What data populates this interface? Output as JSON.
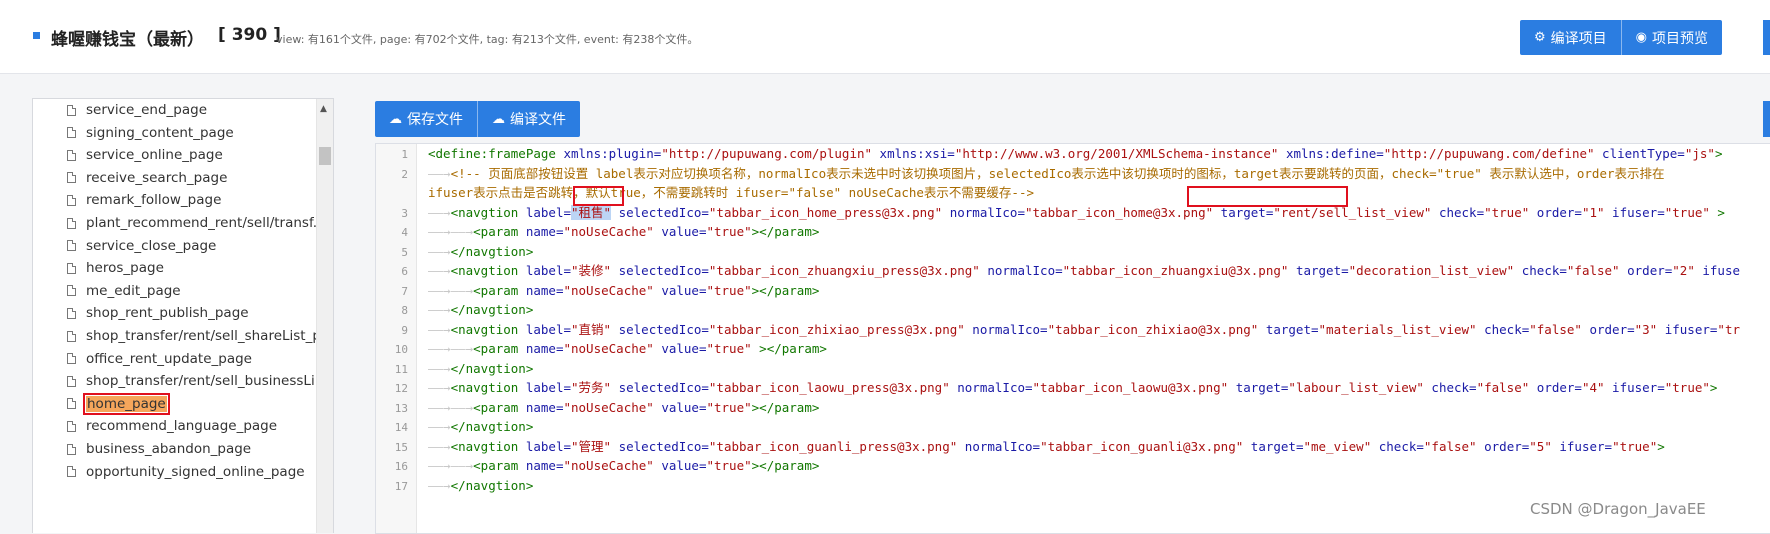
{
  "header": {
    "title": "蜂喔赚钱宝（最新）",
    "count": "[ 390 ]",
    "stats": "view: 有161个文件, page: 有702个文件, tag: 有213个文件, event: 有238个文件。",
    "compile_project_label": "编译项目",
    "preview_project_label": "项目预览"
  },
  "toolbar": {
    "save_file_label": "保存文件",
    "compile_file_label": "编译文件"
  },
  "sidebar": {
    "items": [
      {
        "label": "service_end_page"
      },
      {
        "label": "signing_content_page"
      },
      {
        "label": "service_online_page"
      },
      {
        "label": "receive_search_page"
      },
      {
        "label": "remark_follow_page"
      },
      {
        "label": "plant_recommend_rent/sell/transf..."
      },
      {
        "label": "service_close_page"
      },
      {
        "label": "heros_page"
      },
      {
        "label": "me_edit_page"
      },
      {
        "label": "shop_rent_publish_page"
      },
      {
        "label": "shop_transfer/rent/sell_shareList_p..."
      },
      {
        "label": "office_rent_update_page"
      },
      {
        "label": "shop_transfer/rent/sell_businessLi..."
      },
      {
        "label": "home_page",
        "selected": true
      },
      {
        "label": "recommend_language_page"
      },
      {
        "label": "business_abandon_page"
      },
      {
        "label": "opportunity_signed_online_page"
      }
    ]
  },
  "editor": {
    "line_numbers": [
      "1",
      "2",
      "",
      "3",
      "4",
      "5",
      "6",
      "7",
      "8",
      "9",
      "10",
      "11",
      "12",
      "13",
      "14",
      "15",
      "16",
      "17"
    ],
    "lines": [
      {
        "arrows": "",
        "segments": [
          [
            "tag",
            "<define:framePage "
          ],
          [
            "attr",
            "xmlns:plugin="
          ],
          [
            "val",
            "\"http://pupuwang.com/plugin\""
          ],
          [
            "attr",
            " xmlns:xsi="
          ],
          [
            "val",
            "\"http://www.w3.org/2001/XMLSchema-instance\""
          ],
          [
            "attr",
            " xmlns:define="
          ],
          [
            "val",
            "\"http://pupuwang.com/define\""
          ],
          [
            "attr",
            " clientType="
          ],
          [
            "val",
            "\"js\""
          ],
          [
            "tag",
            ">"
          ]
        ]
      },
      {
        "arrows": "——→",
        "segments": [
          [
            "cmt",
            "<!-- 页面底部按钮设置 label表示对应切换项名称，normalIco表示未选中时该切换项图片，selectedIco表示选中该切换项时的图标，target表示要跳转的页面，check=\"true\" 表示默认选中，order表示排在"
          ]
        ]
      },
      {
        "arrows": "",
        "segments": [
          [
            "cmt",
            "ifuser表示点击是否跳转，默认true，不需要跳转时 ifuser=\"false\" noUseCache表示不需要缓存-->"
          ]
        ]
      },
      {
        "arrows": "——→",
        "segments": [
          [
            "tag",
            "<navgtion "
          ],
          [
            "attr",
            "label="
          ],
          [
            "val",
            "\"租售\""
          ],
          [
            "attr",
            " selectedIco="
          ],
          [
            "val",
            "\"tabbar_icon_home_press@3x.png\""
          ],
          [
            "attr",
            " normalIco="
          ],
          [
            "val",
            "\"tabbar_icon_home@3x.png\""
          ],
          [
            "attr",
            " target="
          ],
          [
            "val",
            "\"rent/sell_list_view\""
          ],
          [
            "attr",
            " check="
          ],
          [
            "val",
            "\"true\""
          ],
          [
            "attr",
            " order="
          ],
          [
            "val",
            "\"1\""
          ],
          [
            "attr",
            " ifuser="
          ],
          [
            "val",
            "\"true\""
          ],
          [
            "tag",
            " >"
          ]
        ]
      },
      {
        "arrows": "——→——→",
        "segments": [
          [
            "tag",
            "<param "
          ],
          [
            "attr",
            "name="
          ],
          [
            "val",
            "\"noUseCache\""
          ],
          [
            "attr",
            " value="
          ],
          [
            "val",
            "\"true\""
          ],
          [
            "tag",
            "></param>"
          ]
        ]
      },
      {
        "arrows": "——→",
        "segments": [
          [
            "tag",
            "</navgtion>"
          ]
        ]
      },
      {
        "arrows": "——→",
        "segments": [
          [
            "tag",
            "<navgtion "
          ],
          [
            "attr",
            "label="
          ],
          [
            "val",
            "\"装修\""
          ],
          [
            "attr",
            " selectedIco="
          ],
          [
            "val",
            "\"tabbar_icon_zhuangxiu_press@3x.png\""
          ],
          [
            "attr",
            " normalIco="
          ],
          [
            "val",
            "\"tabbar_icon_zhuangxiu@3x.png\""
          ],
          [
            "attr",
            " target="
          ],
          [
            "val",
            "\"decoration_list_view\""
          ],
          [
            "attr",
            " check="
          ],
          [
            "val",
            "\"false\""
          ],
          [
            "attr",
            " order="
          ],
          [
            "val",
            "\"2\""
          ],
          [
            "attr",
            " ifuse"
          ]
        ]
      },
      {
        "arrows": "——→——→",
        "segments": [
          [
            "tag",
            "<param "
          ],
          [
            "attr",
            "name="
          ],
          [
            "val",
            "\"noUseCache\""
          ],
          [
            "attr",
            " value="
          ],
          [
            "val",
            "\"true\""
          ],
          [
            "tag",
            "></param>"
          ]
        ]
      },
      {
        "arrows": "——→",
        "segments": [
          [
            "tag",
            "</navgtion>"
          ]
        ]
      },
      {
        "arrows": "——→",
        "segments": [
          [
            "tag",
            "<navgtion "
          ],
          [
            "attr",
            "label="
          ],
          [
            "val",
            "\"直销\""
          ],
          [
            "attr",
            " selectedIco="
          ],
          [
            "val",
            "\"tabbar_icon_zhixiao_press@3x.png\""
          ],
          [
            "attr",
            " normalIco="
          ],
          [
            "val",
            "\"tabbar_icon_zhixiao@3x.png\""
          ],
          [
            "attr",
            " target="
          ],
          [
            "val",
            "\"materials_list_view\""
          ],
          [
            "attr",
            " check="
          ],
          [
            "val",
            "\"false\""
          ],
          [
            "attr",
            " order="
          ],
          [
            "val",
            "\"3\""
          ],
          [
            "attr",
            " ifuser="
          ],
          [
            "val",
            "\"tr"
          ]
        ]
      },
      {
        "arrows": "——→——→",
        "segments": [
          [
            "tag",
            "<param "
          ],
          [
            "attr",
            "name="
          ],
          [
            "val",
            "\"noUseCache\""
          ],
          [
            "attr",
            " value="
          ],
          [
            "val",
            "\"true\""
          ],
          [
            "tag",
            " ></param>"
          ]
        ]
      },
      {
        "arrows": "——→",
        "segments": [
          [
            "tag",
            "</navgtion>"
          ]
        ]
      },
      {
        "arrows": "——→",
        "segments": [
          [
            "tag",
            "<navgtion "
          ],
          [
            "attr",
            "label="
          ],
          [
            "val",
            "\"劳务\""
          ],
          [
            "attr",
            " selectedIco="
          ],
          [
            "val",
            "\"tabbar_icon_laowu_press@3x.png\""
          ],
          [
            "attr",
            " normalIco="
          ],
          [
            "val",
            "\"tabbar_icon_laowu@3x.png\""
          ],
          [
            "attr",
            " target="
          ],
          [
            "val",
            "\"labour_list_view\""
          ],
          [
            "attr",
            " check="
          ],
          [
            "val",
            "\"false\""
          ],
          [
            "attr",
            " order="
          ],
          [
            "val",
            "\"4\""
          ],
          [
            "attr",
            " ifuser="
          ],
          [
            "val",
            "\"true\""
          ],
          [
            "tag",
            ">"
          ]
        ]
      },
      {
        "arrows": "——→——→",
        "segments": [
          [
            "tag",
            "<param "
          ],
          [
            "attr",
            "name="
          ],
          [
            "val",
            "\"noUseCache\""
          ],
          [
            "attr",
            " value="
          ],
          [
            "val",
            "\"true\""
          ],
          [
            "tag",
            "></param>"
          ]
        ]
      },
      {
        "arrows": "——→",
        "segments": [
          [
            "tag",
            "</navgtion>"
          ]
        ]
      },
      {
        "arrows": "——→",
        "segments": [
          [
            "tag",
            "<navgtion "
          ],
          [
            "attr",
            "label="
          ],
          [
            "val",
            "\"管理\""
          ],
          [
            "attr",
            " selectedIco="
          ],
          [
            "val",
            "\"tabbar_icon_guanli_press@3x.png\""
          ],
          [
            "attr",
            " normalIco="
          ],
          [
            "val",
            "\"tabbar_icon_guanli@3x.png\""
          ],
          [
            "attr",
            " target="
          ],
          [
            "val",
            "\"me_view\""
          ],
          [
            "attr",
            " check="
          ],
          [
            "val",
            "\"false\""
          ],
          [
            "attr",
            " order="
          ],
          [
            "val",
            "\"5\""
          ],
          [
            "attr",
            " ifuser="
          ],
          [
            "val",
            "\"true\""
          ],
          [
            "tag",
            ">"
          ]
        ]
      },
      {
        "arrows": "——→——→",
        "segments": [
          [
            "tag",
            "<param "
          ],
          [
            "attr",
            "name="
          ],
          [
            "val",
            "\"noUseCache\""
          ],
          [
            "attr",
            " value="
          ],
          [
            "val",
            "\"true\""
          ],
          [
            "tag",
            "></param>"
          ]
        ]
      },
      {
        "arrows": "——→",
        "segments": [
          [
            "tag",
            "</navgtion>"
          ]
        ]
      }
    ]
  },
  "watermark": "CSDN @Dragon_JavaEE",
  "icons": {
    "compile_project": "gear-icon",
    "preview_project": "eye-icon",
    "save_file": "cloud-upload-icon",
    "compile_file": "cloud-upload-icon",
    "file": "document-icon"
  },
  "colors": {
    "accent": "#2b7de1",
    "highlight": "#e0101e",
    "selected_bg": "#f5a65b"
  }
}
